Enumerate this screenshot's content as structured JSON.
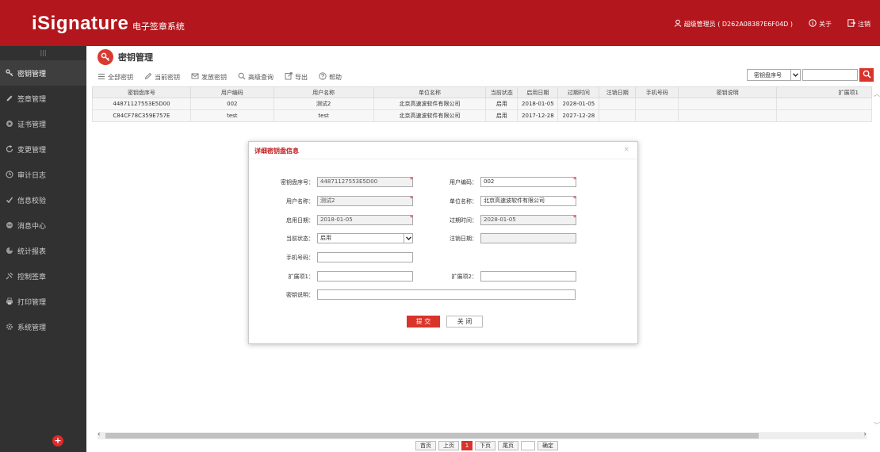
{
  "app": {
    "logo_main": "iSignature",
    "logo_sub": "电子签章系统"
  },
  "header": {
    "user": "超级管理员 ( D262A08387E6F04D )",
    "about": "关于",
    "logout": "注销"
  },
  "sidebar": {
    "toggle": "|||",
    "items": [
      {
        "label": "密钥管理",
        "icon": "key-icon"
      },
      {
        "label": "签章管理",
        "icon": "pen-icon"
      },
      {
        "label": "证书管理",
        "icon": "certificate-icon"
      },
      {
        "label": "变更管理",
        "icon": "refresh-icon"
      },
      {
        "label": "审计日志",
        "icon": "clock-icon"
      },
      {
        "label": "信息校验",
        "icon": "check-icon"
      },
      {
        "label": "消息中心",
        "icon": "message-icon"
      },
      {
        "label": "统计报表",
        "icon": "chart-icon"
      },
      {
        "label": "控制签章",
        "icon": "control-icon"
      },
      {
        "label": "打印管理",
        "icon": "printer-icon"
      },
      {
        "label": "系统管理",
        "icon": "gear-icon"
      }
    ],
    "add": "+"
  },
  "page": {
    "title": "密钥管理"
  },
  "toolbar": {
    "all_keys": "全部密钥",
    "current_key": "当前密钥",
    "issue_key": "发放密钥",
    "advanced_search": "高级查询",
    "export": "导出",
    "help": "帮助"
  },
  "search": {
    "field": "密钥盘序号",
    "value": ""
  },
  "table": {
    "columns": [
      "密钥盘序号",
      "用户编码",
      "用户名称",
      "单位名称",
      "当前状态",
      "启用日期",
      "过期时间",
      "注销日期",
      "手机号码",
      "密钥说明",
      "扩展项1"
    ],
    "rows": [
      [
        "44871127553E5D00",
        "002",
        "测试2",
        "北京高速波软件有限公司",
        "启用",
        "2018-01-05",
        "2028-01-05",
        "",
        "",
        "",
        ""
      ],
      [
        "C84CF78C359E757E",
        "test",
        "test",
        "北京高速波软件有限公司",
        "启用",
        "2017-12-28",
        "2027-12-28",
        "",
        "",
        "",
        ""
      ]
    ]
  },
  "pager": {
    "first": "首页",
    "prev": "上页",
    "current": "1",
    "next": "下页",
    "last": "尾页",
    "goto_value": "",
    "confirm": "确定"
  },
  "modal": {
    "title": "详细密钥盘信息",
    "close": "×",
    "fields": {
      "serial_label": "密钥盘序号：",
      "serial_value": "44871127553E5D00",
      "user_code_label": "用户编码：",
      "user_code_value": "002",
      "user_name_label": "用户名称：",
      "user_name_value": "测试2",
      "unit_label": "单位名称：",
      "unit_value": "北京高速波软件有限公司",
      "start_label": "启用日期：",
      "start_value": "2018-01-05",
      "expire_label": "过期时间：",
      "expire_value": "2028-01-05",
      "status_label": "当前状态：",
      "status_value": "启用",
      "cancel_label": "注销日期：",
      "cancel_value": "",
      "phone_label": "手机号码：",
      "phone_value": "",
      "ext1_label": "扩展项1：",
      "ext1_value": "",
      "ext2_label": "扩展项2：",
      "ext2_value": "",
      "desc_label": "密钥说明：",
      "desc_value": ""
    },
    "submit": "提 交",
    "cancel": "关 闭"
  },
  "colors": {
    "brand_red": "#b3161c",
    "accent_red": "#d9342b",
    "sidebar_bg": "#313131"
  }
}
